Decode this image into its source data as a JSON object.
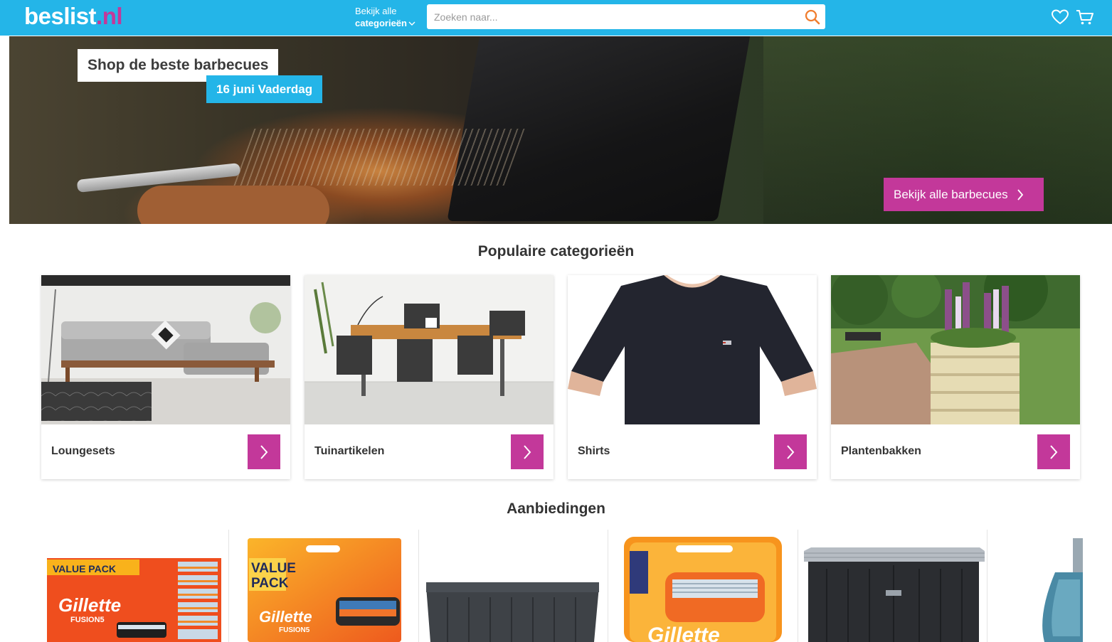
{
  "header": {
    "logo_main": "beslist",
    "logo_dot": ".",
    "logo_tld": "nl",
    "categories_line1": "Bekijk alle",
    "categories_line2": "categorieën",
    "search_placeholder": "Zoeken naar...",
    "icons": [
      "search-icon",
      "heart-icon",
      "cart-icon",
      "chevron-down-icon"
    ]
  },
  "hero": {
    "title": "Shop de beste barbecues",
    "badge": "16 juni Vaderdag",
    "cta": "Bekijk alle barbecues"
  },
  "popular": {
    "heading": "Populaire categorieën",
    "items": [
      {
        "label": "Loungesets"
      },
      {
        "label": "Tuinartikelen"
      },
      {
        "label": "Shirts"
      },
      {
        "label": "Plantenbakken"
      }
    ]
  },
  "deals": {
    "heading": "Aanbiedingen",
    "items": [
      {
        "pack_line1": "VALUE PACK",
        "brand": "Gillette",
        "sub": "FUSION5"
      },
      {
        "pack_line1": "VALUE",
        "pack_line2": "PACK",
        "brand": "Gillette",
        "sub": "FUSION5"
      },
      {
        "product": "storage box"
      },
      {
        "brand": "Gillette"
      },
      {
        "product": "storage box"
      },
      {
        "product": "perfume"
      }
    ]
  },
  "colors": {
    "header_blue": "#24b5e8",
    "accent_pink": "#c3389a"
  }
}
